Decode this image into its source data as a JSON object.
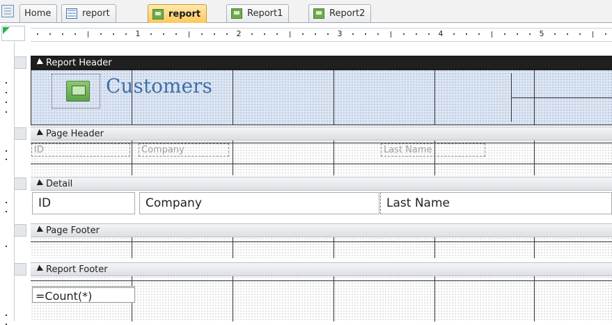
{
  "tabs": [
    {
      "label": "Home",
      "icon": "table-icon"
    },
    {
      "label": "report",
      "icon": "table-icon"
    },
    {
      "label": "report",
      "icon": "report-icon",
      "active": true
    },
    {
      "label": "Report1",
      "icon": "report-icon"
    },
    {
      "label": "Report2",
      "icon": "report-icon"
    }
  ],
  "ruler": {
    "numbers": [
      "1",
      "2",
      "3",
      "4",
      "5"
    ]
  },
  "sections": {
    "report_header": "Report Header",
    "page_header": "Page Header",
    "detail": "Detail",
    "page_footer": "Page Footer",
    "report_footer": "Report Footer"
  },
  "report_header": {
    "title": "Customers",
    "logo_icon": "report-logo-icon"
  },
  "page_header": {
    "labels": [
      "ID",
      "Company",
      "Last Name"
    ]
  },
  "detail": {
    "fields": [
      "ID",
      "Company",
      "Last Name"
    ]
  },
  "report_footer": {
    "expression": "=Count(*)"
  },
  "colors": {
    "active_tab": "#fbc85f",
    "header_bar": "#1f1f1f",
    "title": "#3f6fa6",
    "header_area": "#dce6f4"
  }
}
